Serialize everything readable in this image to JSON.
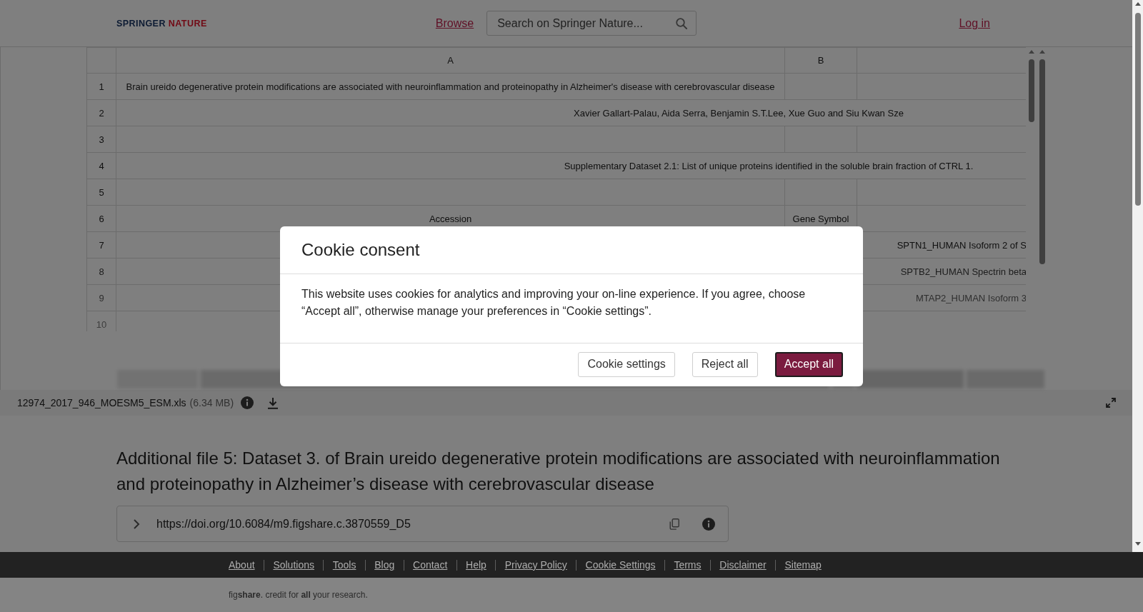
{
  "header": {
    "logo": [
      "SPRINGER",
      "NATURE"
    ],
    "browse_link": "Browse",
    "search": {
      "placeholder": "Search on Springer Nature..."
    },
    "login_link": "Log in"
  },
  "spreadsheet": {
    "columns": [
      "A",
      "B"
    ],
    "rows": [
      {
        "number": "1",
        "kind": "cells",
        "A": "Brain ureido degenerative protein modifications are associated with neuroinflammation and proteinopathy in Alzheimer's disease with cerebrovascular disease"
      },
      {
        "number": "2",
        "kind": "merged",
        "text": "Xavier Gallart-Palau, Aida Serra, Benjamin S.T.Lee, Xue Guo and Siu Kwan Sze"
      },
      {
        "number": "3",
        "kind": "cells"
      },
      {
        "number": "4",
        "kind": "merged",
        "text": "Supplementary Dataset 2.1: List of unique proteins identified in the soluble brain fraction of CTRL 1."
      },
      {
        "number": "5",
        "kind": "cells"
      },
      {
        "number": "6",
        "kind": "cells",
        "A": "Accession",
        "B": "Gene Symbol"
      },
      {
        "number": "7",
        "kind": "cells",
        "column_3": "SPTN1_HUMAN Isoform 2 of S"
      },
      {
        "number": "8",
        "kind": "cells",
        "column_3": "SPTB2_HUMAN Spectrin beta"
      },
      {
        "number": "9",
        "kind": "cells",
        "column_3": "MTAP2_HUMAN Isoform 3"
      },
      {
        "number": "10",
        "kind": "cells"
      }
    ]
  },
  "file_bar": {
    "file_name": "12974_2017_946_MOESM5_ESM.xls",
    "file_size": "(6.34 MB)"
  },
  "item": {
    "title": "Additional file 5: Dataset 3. of Brain ureido degenerative protein modifications are associated with neuroinflammation and proteinopathy in Alzheimer’s disease with cerebrovascular disease",
    "doi": "https://doi.org/10.6084/m9.figshare.c.3870559_D5"
  },
  "footer": {
    "links": [
      "About",
      "Solutions",
      "Tools",
      "Blog",
      "Contact",
      "Help",
      "Privacy Policy",
      "Cookie Settings",
      "Terms",
      "Disclaimer",
      "Sitemap"
    ],
    "tagline": "fig**share**. credit for **all** your research."
  },
  "cookie_dialog": {
    "title": "Cookie consent",
    "message": "This website uses cookies for analytics and improving your on-line experience. If you agree, choose “Accept all”, otherwise manage your preferences in “Cookie settings”.",
    "buttons": [
      {
        "label": "Cookie settings",
        "kind": "secondary",
        "focused": false
      },
      {
        "label": "Reject all",
        "kind": "secondary",
        "focused": false
      },
      {
        "label": "Accept all",
        "kind": "primary",
        "focused": true
      }
    ]
  }
}
